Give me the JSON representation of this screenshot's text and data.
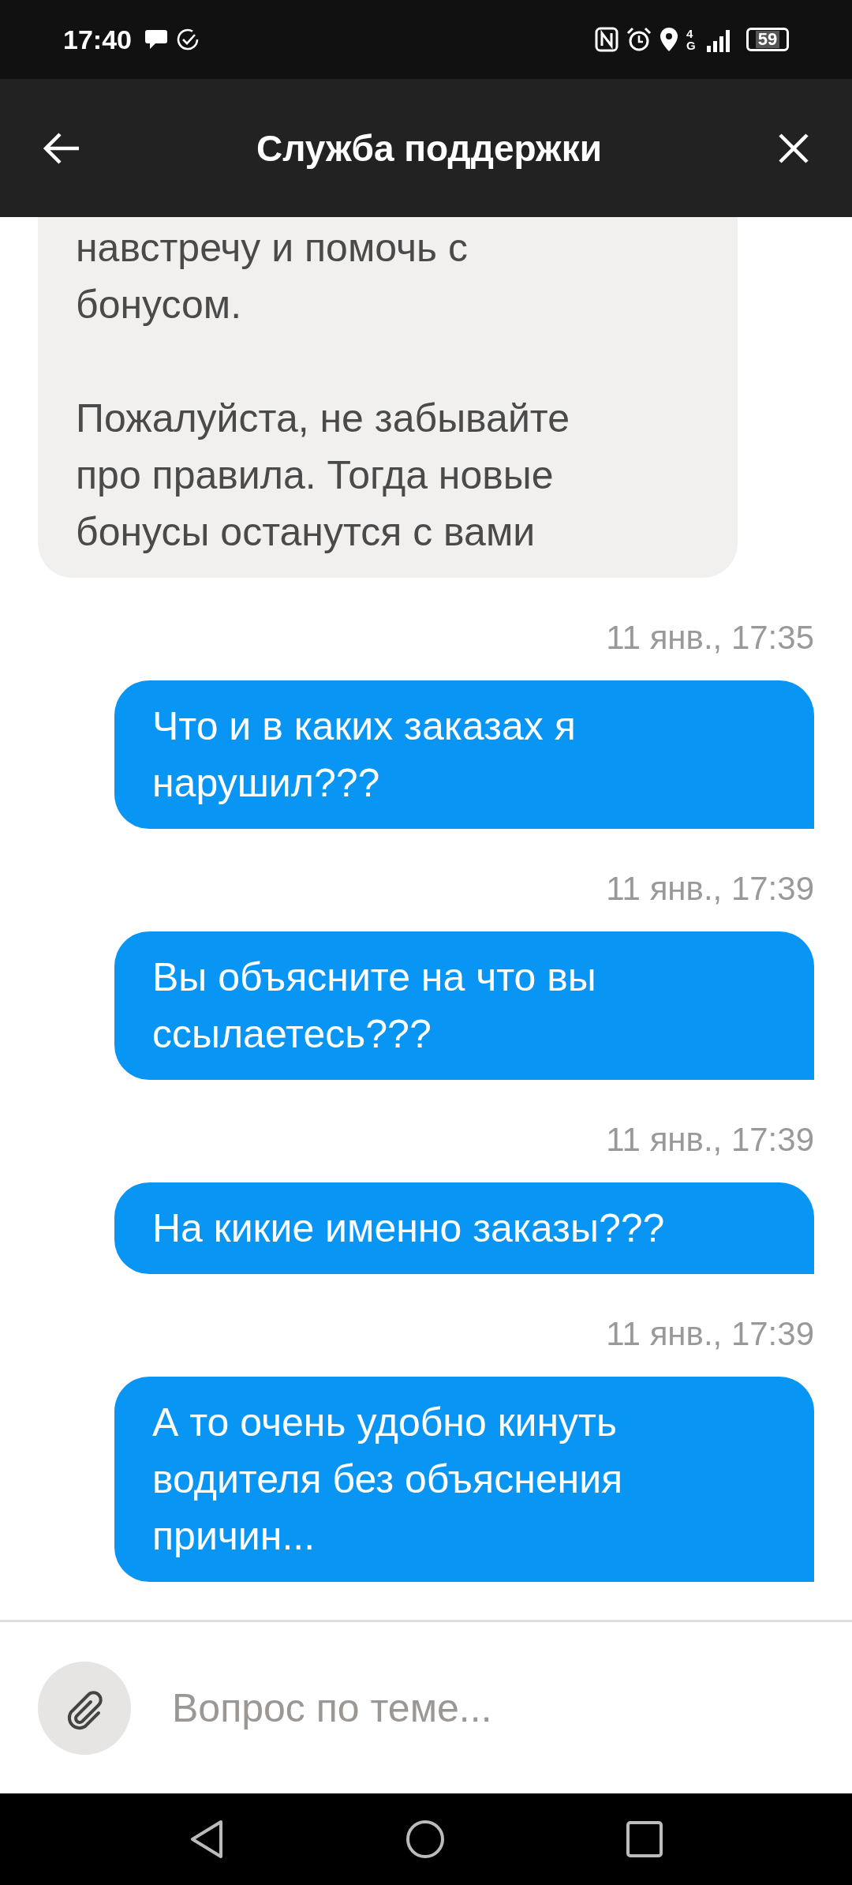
{
  "status_bar": {
    "time": "17:40",
    "network": "4G",
    "battery": "59"
  },
  "header": {
    "title": "Служба поддержки"
  },
  "messages": [
    {
      "kind": "incoming",
      "text": "навстречу и помочь с\nбонусом.\n\nПожалуйста, не забывайте\nпро правила. Тогда новые\nбонусы останутся с вами"
    },
    {
      "kind": "outgoing",
      "time": "11 янв., 17:35",
      "text": "Что и в каких заказах я\nнарушил???"
    },
    {
      "kind": "outgoing",
      "time": "11 янв., 17:39",
      "text": "Вы объясните на что вы\nссылаетесь???"
    },
    {
      "kind": "outgoing",
      "time": "11 янв., 17:39",
      "text": "На кикие именно заказы???"
    },
    {
      "kind": "outgoing",
      "time": "11 янв., 17:39",
      "text": "А то очень удобно кинуть\nводителя без объяснения\nпричин..."
    }
  ],
  "composer": {
    "placeholder": "Вопрос по теме..."
  }
}
